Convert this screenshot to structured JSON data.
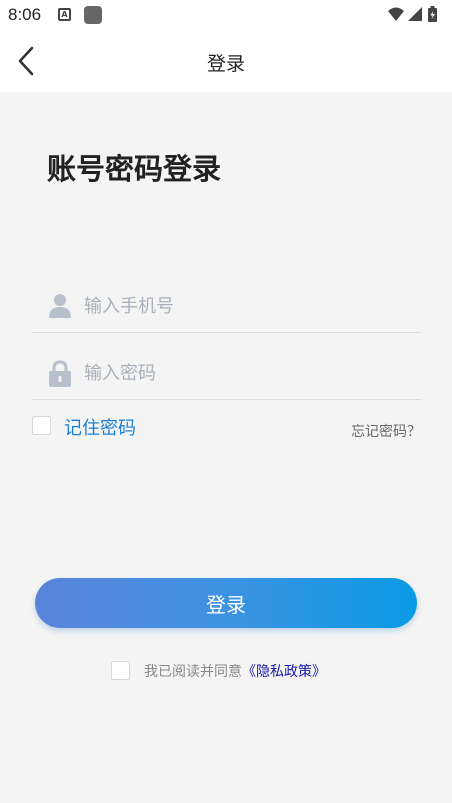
{
  "status_bar": {
    "time": "8:06",
    "a_icon_letter": "A"
  },
  "header": {
    "title": "登录"
  },
  "page": {
    "heading": "账号密码登录"
  },
  "form": {
    "phone_placeholder": "输入手机号",
    "password_placeholder": "输入密码",
    "remember_label": "记住密码",
    "forgot_label": "忘记密码？",
    "login_button": "登录"
  },
  "agreement": {
    "text": "我已阅读并同意",
    "policy_link": "《隐私政策》"
  },
  "colors": {
    "accent": "#1a7fd4",
    "button_gradient_start": "#5a83db",
    "button_gradient_end": "#0a9be5",
    "link": "#1a1aa8",
    "background": "#f4f4f4"
  }
}
